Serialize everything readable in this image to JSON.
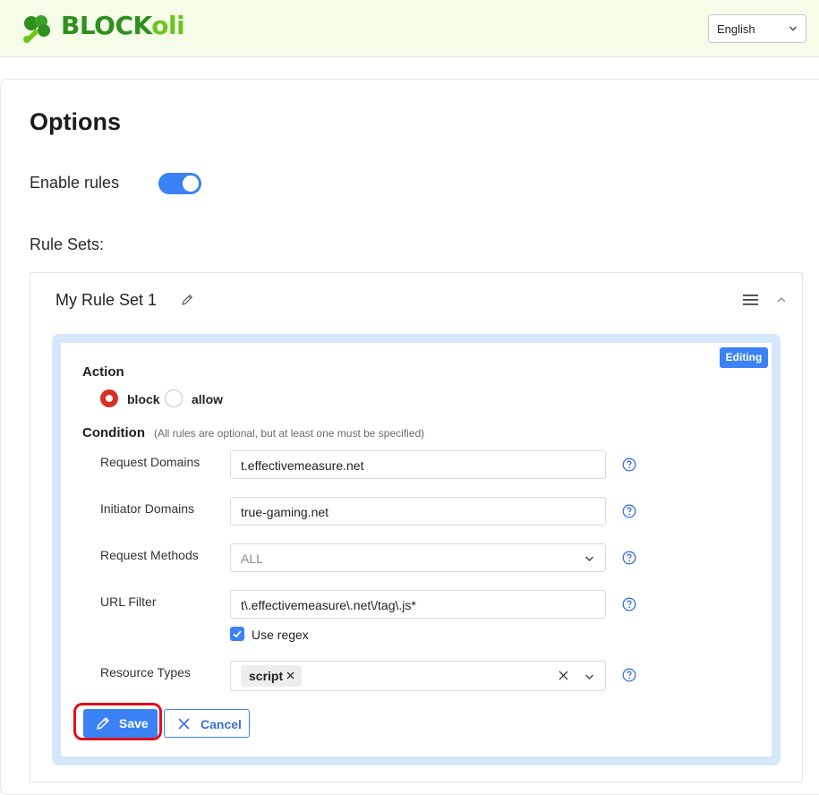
{
  "header": {
    "logo_part1": "BLOCK",
    "logo_part2": "oli",
    "language": "English",
    "colors": {
      "logo_dark": "#2f8f1f",
      "logo_light": "#6cc51d",
      "background": "#f5fde8"
    }
  },
  "options": {
    "title": "Options",
    "enable_rules_label": "Enable rules",
    "enable_rules_on": true,
    "rule_sets_label": "Rule Sets:"
  },
  "ruleset": {
    "name": "My Rule Set 1",
    "editing_badge": "Editing",
    "action": {
      "title": "Action",
      "options": [
        {
          "label": "block",
          "selected": true
        },
        {
          "label": "allow",
          "selected": false
        }
      ]
    },
    "condition": {
      "title": "Condition",
      "hint": "(All rules are optional, but at least one must be specified)",
      "request_domains": {
        "label": "Request Domains",
        "value": "t.effectivemeasure.net"
      },
      "initiator_domains": {
        "label": "Initiator Domains",
        "value": "true-gaming.net"
      },
      "request_methods": {
        "label": "Request Methods",
        "value": "ALL"
      },
      "url_filter": {
        "label": "URL Filter",
        "value": "t\\.effectivemeasure\\.net\\/tag\\.js*"
      },
      "use_regex": {
        "label": "Use regex",
        "checked": true
      },
      "resource_types": {
        "label": "Resource Types",
        "tags": [
          "script"
        ]
      }
    },
    "buttons": {
      "save": "Save",
      "cancel": "Cancel"
    }
  },
  "accent_color": "#3b82f6"
}
